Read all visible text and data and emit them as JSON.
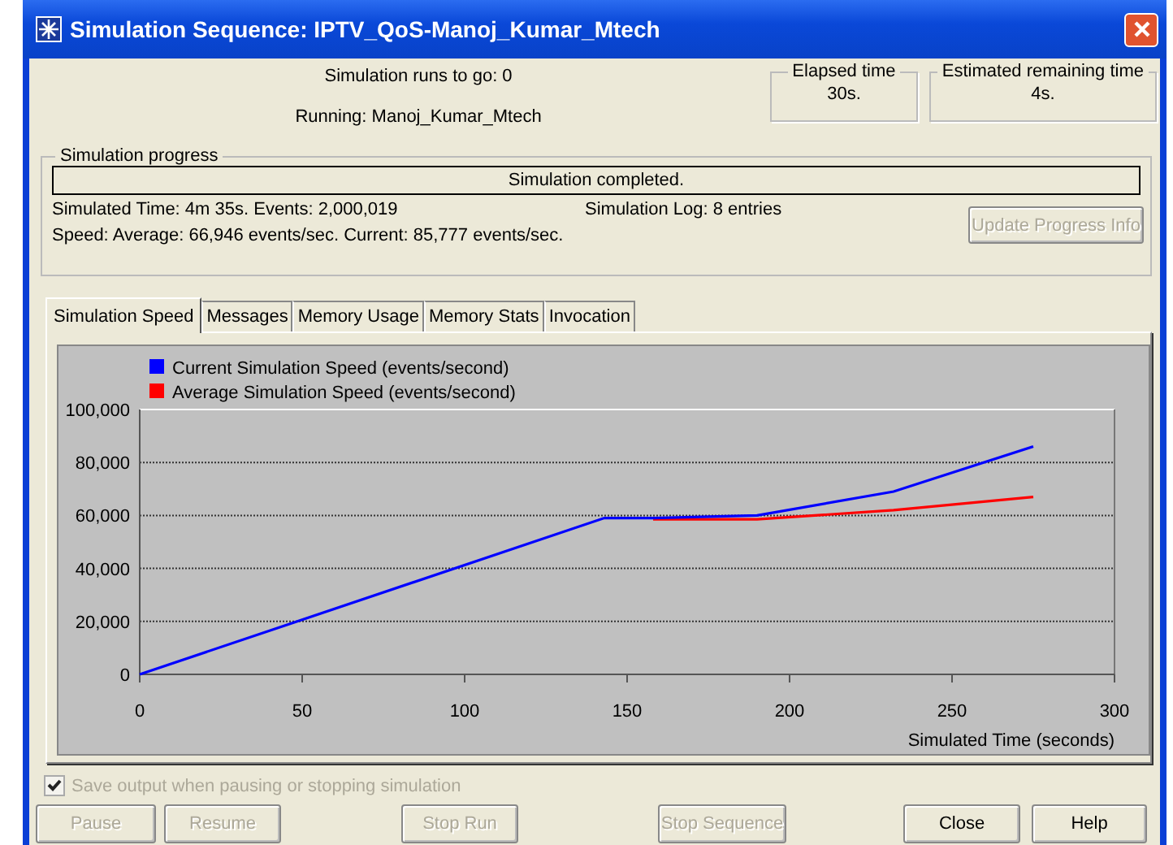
{
  "window": {
    "title": "Simulation Sequence: IPTV_QoS-Manoj_Kumar_Mtech"
  },
  "status": {
    "runs_to_go": "Simulation runs to go:  0",
    "running": "Running:  Manoj_Kumar_Mtech"
  },
  "elapsed_time": {
    "label": "Elapsed time",
    "value": "30s."
  },
  "remaining_time": {
    "label": "Estimated remaining time",
    "value": "4s."
  },
  "progress": {
    "title": "Simulation progress",
    "message": "Simulation completed.",
    "simulated_time": "Simulated Time:  4m 35s.  Events:  2,000,019",
    "log": "Simulation Log: 8 entries",
    "speed": "Speed: Average:  66,946  events/sec. Current:  85,777  events/sec.",
    "update_button": {
      "label": "Update Progress Info",
      "disabled": true
    }
  },
  "tabs": [
    {
      "label": "Simulation Speed",
      "selected": true
    },
    {
      "label": "Messages",
      "selected": false
    },
    {
      "label": "Memory Usage",
      "selected": false
    },
    {
      "label": "Memory Stats",
      "selected": false
    },
    {
      "label": "Invocation",
      "selected": false
    }
  ],
  "chart": {
    "chart_data": {
      "type": "line",
      "grid": true,
      "legend": "top left",
      "xlabel": "Simulated Time (seconds)",
      "x": [
        0,
        143,
        158,
        190,
        232,
        275
      ],
      "series": [
        {
          "name": "Current Simulation Speed (events/second)",
          "color": "#0000ff",
          "values": [
            0,
            59000,
            59000,
            60000,
            69000,
            86000
          ]
        },
        {
          "name": "Average Simulation Speed (events/second)",
          "color": "#ff0000",
          "values": [
            null,
            null,
            58500,
            58500,
            62000,
            67000
          ]
        }
      ],
      "xlim": [
        0,
        300
      ],
      "ylim": [
        0,
        100000
      ],
      "xticks": [
        0,
        50,
        100,
        150,
        200,
        250,
        300
      ],
      "yticks": [
        {
          "value": 0,
          "label": "0"
        },
        {
          "value": 20000,
          "label": "20,000"
        },
        {
          "value": 40000,
          "label": "40,000"
        },
        {
          "value": 60000,
          "label": "60,000"
        },
        {
          "value": 80000,
          "label": "80,000"
        },
        {
          "value": 100000,
          "label": "100,000"
        }
      ]
    }
  },
  "save_output": {
    "label": "Save output when pausing or stopping simulation",
    "checked": true,
    "disabled": true
  },
  "buttons": [
    {
      "label": "Pause",
      "disabled": true
    },
    {
      "label": "Resume",
      "disabled": true
    },
    {
      "label": "Stop Run",
      "disabled": true
    },
    {
      "label": "Stop Sequence",
      "disabled": true
    },
    {
      "label": "Close",
      "disabled": false
    },
    {
      "label": "Help",
      "disabled": false
    }
  ]
}
